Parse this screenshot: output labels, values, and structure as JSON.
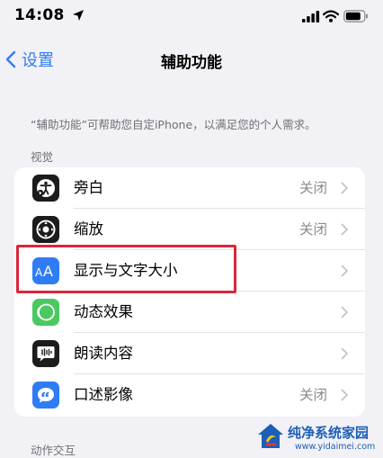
{
  "status_bar": {
    "time": "14:08"
  },
  "nav": {
    "back_label": "设置",
    "title": "辅助功能"
  },
  "description": "“辅助功能”可帮助您自定iPhone，以满足您的个人需求。",
  "sections": [
    {
      "header": "视觉",
      "rows": [
        {
          "label": "旁白",
          "value": "关闭",
          "icon": "voiceover-icon",
          "icon_color": "#1c1c1e"
        },
        {
          "label": "缩放",
          "value": "关闭",
          "icon": "zoom-icon",
          "icon_color": "#1c1c1e"
        },
        {
          "label": "显示与文字大小",
          "value": "",
          "icon": "display-text-size-icon",
          "icon_color": "#2f7cf6"
        },
        {
          "label": "动态效果",
          "value": "",
          "icon": "motion-icon",
          "icon_color": "#4cc861"
        },
        {
          "label": "朗读内容",
          "value": "",
          "icon": "spoken-content-icon",
          "icon_color": "#1c1c1e"
        },
        {
          "label": "口述影像",
          "value": "关闭",
          "icon": "audio-description-icon",
          "icon_color": "#2f7cf6"
        }
      ]
    },
    {
      "header": "动作交互"
    }
  ],
  "highlight_color": "#d9263b",
  "accent_color": "#2f7cf6",
  "watermark": {
    "title": "纯净系统家园",
    "url": "www.yidaimei.com"
  }
}
